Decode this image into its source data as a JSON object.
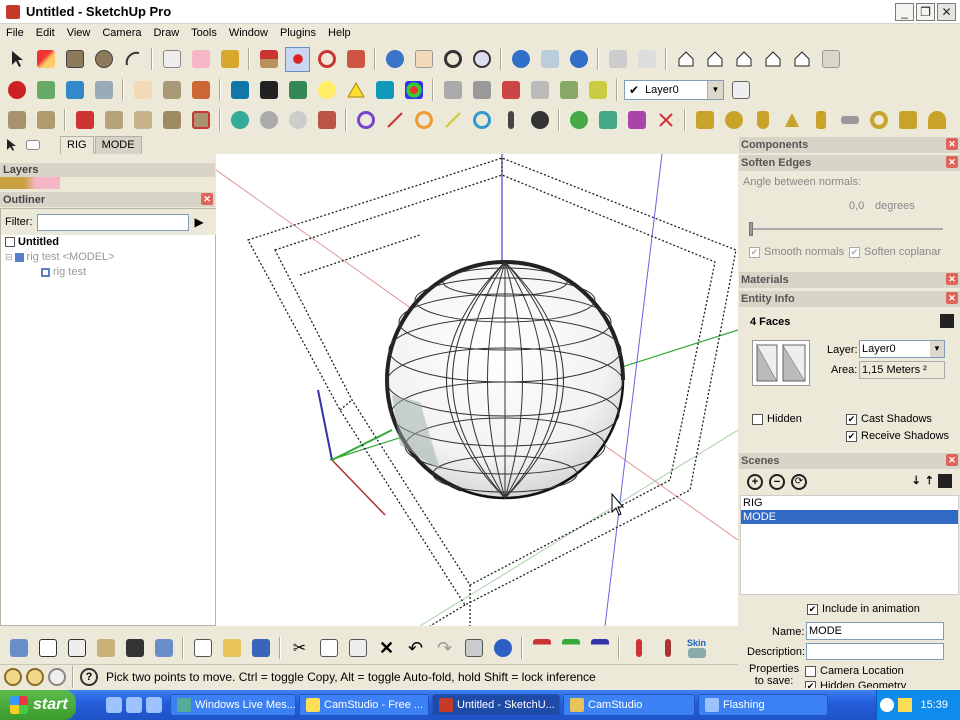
{
  "window": {
    "title": "Untitled - SketchUp Pro"
  },
  "menu": [
    "File",
    "Edit",
    "View",
    "Camera",
    "Draw",
    "Tools",
    "Window",
    "Plugins",
    "Help"
  ],
  "layer_dropdown": {
    "value": "Layer0"
  },
  "scene_tabs": [
    "RIG",
    "MODE"
  ],
  "layers_panel": {
    "title": "Layers"
  },
  "outliner": {
    "title": "Outliner",
    "filter_label": "Filter:",
    "items": [
      "Untitled",
      "rig test <MODEL>",
      "rig test"
    ]
  },
  "components": {
    "title": "Components"
  },
  "soften_edges": {
    "title": "Soften Edges",
    "angle_label": "Angle between normals:",
    "angle_value": "0,0",
    "angle_unit": "degrees",
    "smooth_normals": "Smooth normals",
    "soften_coplanar": "Soften coplanar"
  },
  "materials": {
    "title": "Materials"
  },
  "entity_info": {
    "title": "Entity Info",
    "heading": "4 Faces",
    "layer_label": "Layer:",
    "layer_value": "Layer0",
    "area_label": "Area:",
    "area_value": "1,15 Meters ²",
    "hidden_label": "Hidden",
    "cast_shadows": "Cast Shadows",
    "receive_shadows": "Receive Shadows"
  },
  "scenes": {
    "title": "Scenes",
    "list": [
      "RIG",
      "MODE"
    ],
    "selected": "MODE",
    "include_label": "Include in animation",
    "name_label": "Name:",
    "name_value": "MODE",
    "description_label": "Description:",
    "properties_label": "Properties to save:",
    "camera_location": "Camera Location",
    "hidden_geometry": "Hidden Geometry"
  },
  "status": {
    "text": "Pick two points to move.  Ctrl = toggle Copy, Alt = toggle Auto-fold, hold Shift = lock inference"
  },
  "toolbar_labels": {
    "skin": "Skin"
  },
  "taskbar": {
    "start": "start",
    "tasks": [
      "Windows Live Mes...",
      "CamStudio - Free ...",
      "Untitled - SketchU...",
      "CamStudio",
      "Flashing"
    ],
    "clock": "15:39"
  },
  "colors": {
    "accent": "#245edb",
    "axis_red": "#c44",
    "axis_green": "#2a2",
    "axis_blue": "#44c"
  }
}
